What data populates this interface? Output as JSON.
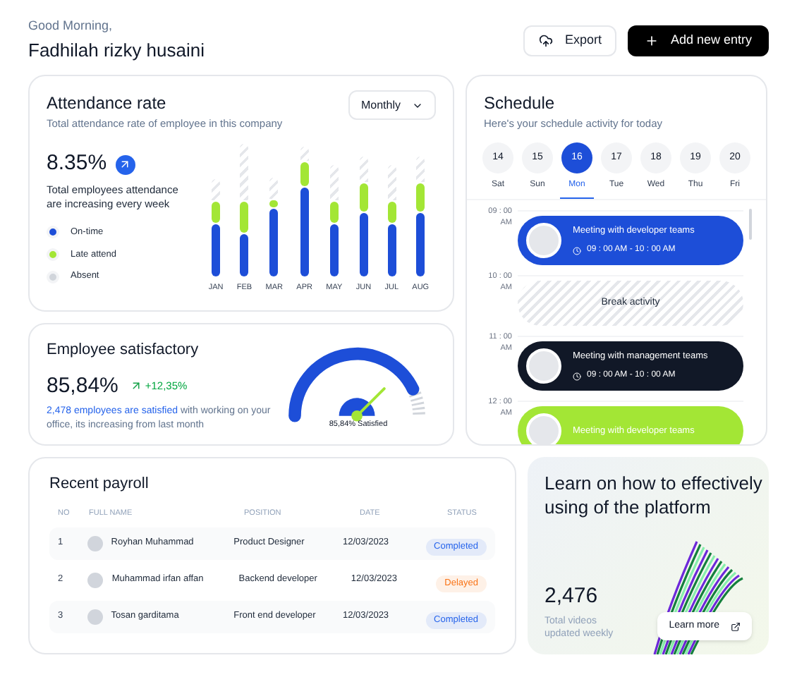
{
  "header": {
    "greeting": "Good Morning,",
    "name": "Fadhilah rizky husaini",
    "buttons": [
      {
        "kind": "secondary",
        "label": "Export"
      },
      {
        "kind": "primary",
        "label": "Add new entry"
      }
    ]
  },
  "attendance": {
    "title": "Attendance rate",
    "subtitle": "Total attendance rate of employee in this company",
    "period": "Monthly",
    "rate": "8.35%",
    "description": "Total employees attendance are increasing every week",
    "legend": [
      {
        "label": "On-time",
        "color": "#1d4ed8"
      },
      {
        "label": "Late attend",
        "color": "#a3e635"
      },
      {
        "label": "Absent",
        "color": "#d1d5db"
      }
    ],
    "months": [
      "JAN",
      "FEB",
      "MAR",
      "APR",
      "MAY",
      "JUN",
      "JUL",
      "AUG"
    ]
  },
  "satisfaction": {
    "title": "Employee satisfactory",
    "value": "85,84%",
    "change": "+12,35%",
    "highlight": "2,478 employees are satisfied",
    "description": " with working on your office, its increasing from last month",
    "gauge_label": "85,84% Satisfied"
  },
  "schedule": {
    "title": "Schedule",
    "subtitle": "Here's your schedule activity for today",
    "days": [
      {
        "date": "14",
        "day": "Sat",
        "selected": false
      },
      {
        "date": "15",
        "day": "Sun",
        "selected": false
      },
      {
        "date": "16",
        "day": "Mon",
        "selected": true
      },
      {
        "date": "17",
        "day": "Tue",
        "selected": false
      },
      {
        "date": "18",
        "day": "Wed",
        "selected": false
      },
      {
        "date": "19",
        "day": "Thu",
        "selected": false
      },
      {
        "date": "20",
        "day": "Fri",
        "selected": false
      }
    ],
    "slots": [
      {
        "time": "09 : 00 AM",
        "event": {
          "kind": "meeting",
          "title": "Meeting with developer teams",
          "time": "09 : 00 AM - 10 : 00 AM",
          "color": "#1d4ed8"
        }
      },
      {
        "time": "10 : 00 AM",
        "event": {
          "kind": "break",
          "title": "Break activity"
        }
      },
      {
        "time": "11 : 00 AM",
        "event": {
          "kind": "meeting",
          "title": "Meeting with management teams",
          "time": "09 : 00 AM - 10 : 00 AM",
          "color": "#111827"
        }
      },
      {
        "time": "12 : 00 AM",
        "event": {
          "kind": "meeting",
          "title": "Meeting with developer teams",
          "color": "#a3e635"
        }
      }
    ]
  },
  "payroll": {
    "title": "Recent payroll",
    "columns": [
      "NO",
      "FULL NAME",
      "POSITION",
      "DATE",
      "STATUS"
    ],
    "rows": [
      {
        "no": "1",
        "name": "Royhan Muhammad",
        "position": "Product Designer",
        "date": "12/03/2023",
        "status": "Completed",
        "color": "#2563eb"
      },
      {
        "no": "2",
        "name": "Muhammad irfan affan",
        "position": "Backend developer",
        "date": "12/03/2023",
        "status": "Delayed",
        "color": "#f97316"
      },
      {
        "no": "3",
        "name": "Tosan garditama",
        "position": "Front end developer",
        "date": "12/03/2023",
        "status": "Completed",
        "color": "#2563eb"
      }
    ]
  },
  "promo": {
    "title": "Learn on how to effectively using of the platform",
    "count": "2,476",
    "caption": "Total videos updated weekly",
    "button": "Learn more"
  }
}
